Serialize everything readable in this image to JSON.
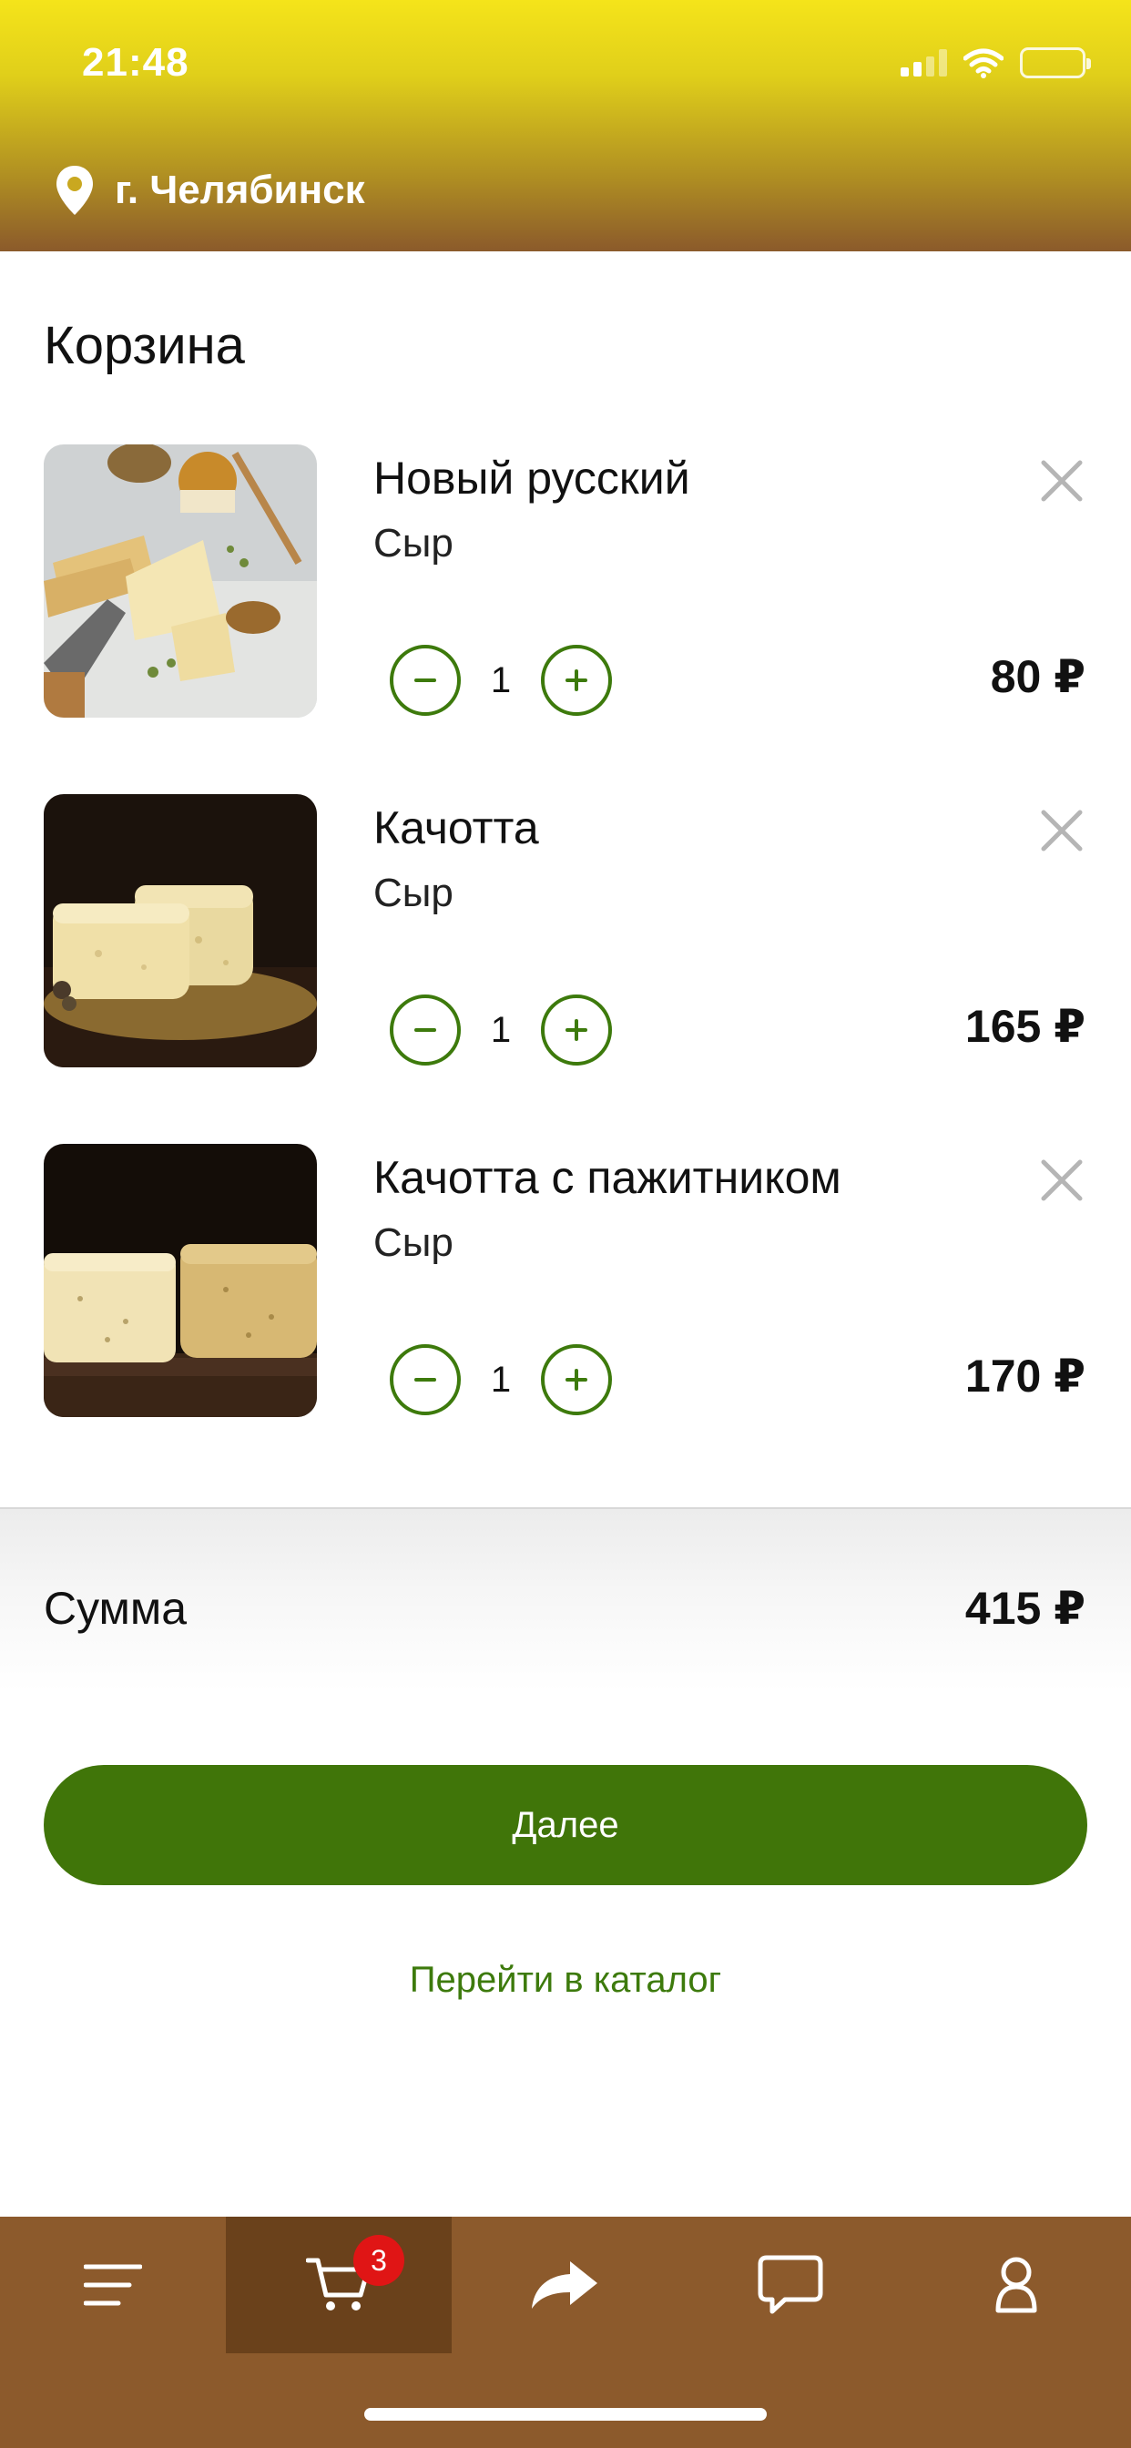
{
  "status_bar": {
    "time": "21:48"
  },
  "header": {
    "location": "г. Челябинск"
  },
  "page": {
    "title": "Корзина"
  },
  "cart_items": [
    {
      "name": "Новый русский",
      "category": "Сыр",
      "quantity": "1",
      "price": "80 ₽"
    },
    {
      "name": "Качотта",
      "category": "Сыр",
      "quantity": "1",
      "price": "165 ₽"
    },
    {
      "name": "Качотта с пажитником",
      "category": "Сыр",
      "quantity": "1",
      "price": "170 ₽"
    }
  ],
  "summary": {
    "label": "Сумма",
    "total": "415 ₽"
  },
  "actions": {
    "next_label": "Далее",
    "catalog_link": "Перейти в каталог"
  },
  "tabbar": {
    "cart_badge": "3",
    "active_tab": "cart"
  },
  "colors": {
    "accent_green": "#407509",
    "header_top": "#f5e41a",
    "header_bottom": "#8b5a2b",
    "tabbar": "#8c5a2c",
    "badge": "#e01515"
  },
  "icons": [
    "location-pin-icon",
    "close-icon",
    "minus-icon",
    "plus-icon",
    "menu-icon",
    "cart-icon",
    "share-arrow-icon",
    "chat-icon",
    "profile-icon"
  ]
}
